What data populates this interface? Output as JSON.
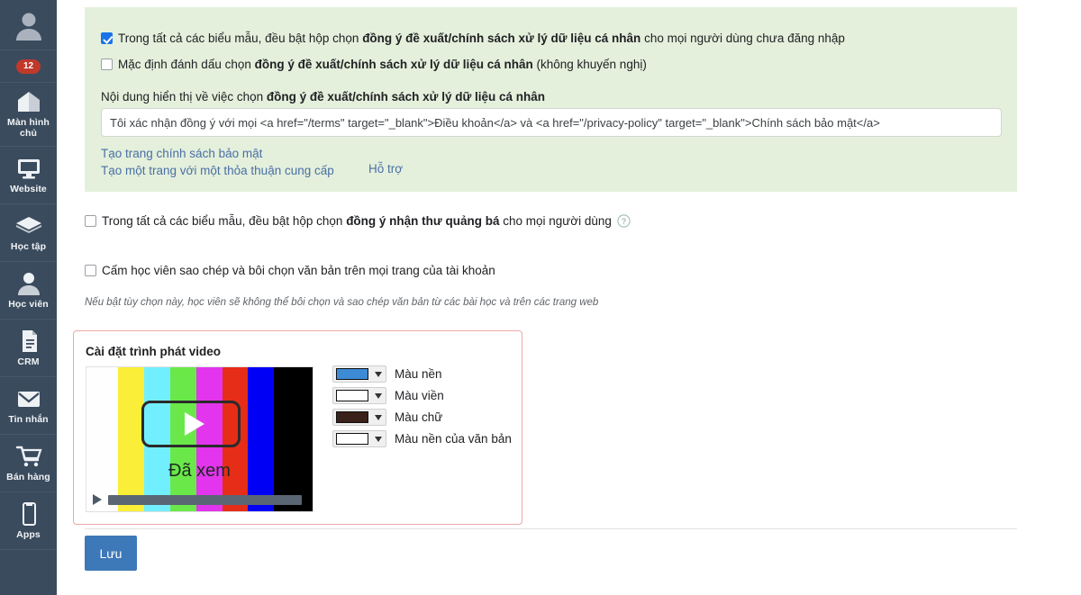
{
  "sidebar": {
    "badge_count": "12",
    "avatar_icon": "user-avatar-icon",
    "items": [
      {
        "label": "Màn hình chủ",
        "icon": "home-icon"
      },
      {
        "label": "Website",
        "icon": "monitor-icon"
      },
      {
        "label": "Học tập",
        "icon": "graduation-cap-icon"
      },
      {
        "label": "Học viên",
        "icon": "person-icon"
      },
      {
        "label": "CRM",
        "icon": "document-icon"
      },
      {
        "label": "Tin nhắn",
        "icon": "envelope-icon"
      },
      {
        "label": "Bán hàng",
        "icon": "shopping-cart-icon"
      },
      {
        "label": "Apps",
        "icon": "mobile-app-icon"
      }
    ]
  },
  "consent_panel": {
    "row1": {
      "checked": true,
      "text_before": "Trong tất cả các biểu mẫu, đều bật hộp chọn ",
      "text_bold": "đồng ý đề xuất/chính sách xử lý dữ liệu cá nhân",
      "text_after": " cho mọi người dùng chưa đăng nhập"
    },
    "row2": {
      "checked": false,
      "text_before": "Mặc định đánh dấu chọn ",
      "text_bold": "đồng ý đề xuất/chính sách xử lý dữ liệu cá nhân",
      "text_after": " (không khuyến nghị)"
    },
    "content_label_before": "Nội dung hiển thị về việc chọn ",
    "content_label_bold": "đồng ý đề xuất/chính sách xử lý dữ liệu cá nhân",
    "content_value": "Tôi xác nhận đồng ý với mọi <a href=\"/terms\" target=\"_blank\">Điều khoản</a> và <a href=\"/privacy-policy\" target=\"_blank\">Chính sách bảo mật</a>",
    "content_placeholder": "Nội dung hiển thị",
    "link_privacy": "Tạo trang chính sách bảo mật",
    "link_agreement": "Tạo một trang với một thỏa thuận cung cấp",
    "link_support": "Hỗ trợ"
  },
  "promo_row": {
    "checked": false,
    "text_before": "Trong tất cả các biểu mẫu, đều bật hộp chọn ",
    "text_bold": "đồng ý nhận thư quảng bá",
    "text_after": " cho mọi người dùng",
    "help_icon": "question-circle-icon"
  },
  "copy_block_row": {
    "checked": false,
    "text": "Cấm học viên sao chép và bôi chọn văn bản trên mọi trang của tài khoản",
    "note": "Nếu bật tùy chọn này, học viên sẽ không thể bôi chọn và sao chép văn bản từ các bài học và trên các trang web"
  },
  "video_panel": {
    "title": "Cài đặt trình phát video",
    "preview": {
      "watched_label": "Đã xem",
      "play_icon": "play-triangle-icon",
      "control_play_icon": "play-small-icon",
      "bars": [
        "#fefefe",
        "#fbee38",
        "#72efff",
        "#6ae84a",
        "#e235ed",
        "#e62d18",
        "#0000f5",
        "#000000"
      ]
    },
    "swatches": [
      {
        "label": "Màu nền",
        "color": "#3d8bd5"
      },
      {
        "label": "Màu viền",
        "color": "#ffffff"
      },
      {
        "label": "Màu chữ",
        "color": "#3a2119"
      },
      {
        "label": "Màu nền của văn bản",
        "color": "#ffffff"
      }
    ]
  },
  "footer": {
    "save_label": "Lưu",
    "save_color": "#3d78b8"
  }
}
